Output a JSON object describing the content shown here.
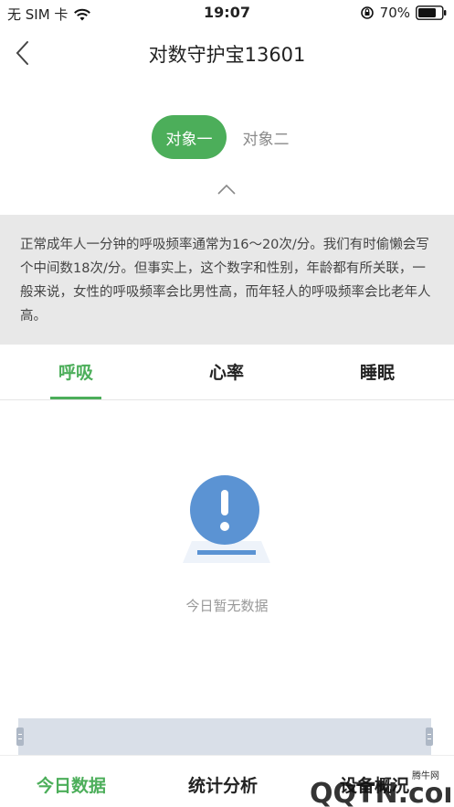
{
  "status_bar": {
    "carrier": "无 SIM 卡",
    "time": "19:07",
    "battery": "70%"
  },
  "nav": {
    "title": "对数守护宝13601"
  },
  "subject_tabs": [
    {
      "label": "对象一",
      "active": true
    },
    {
      "label": "对象二",
      "active": false
    }
  ],
  "info": {
    "text": "正常成年人一分钟的呼吸频率通常为16～20次/分。我们有时偷懒会写个中间数18次/分。但事实上，这个数字和性别，年龄都有所关联，一般来说，女性的呼吸频率会比男性高，而年轻人的呼吸频率会比老年人高。"
  },
  "metric_tabs": [
    {
      "label": "呼吸",
      "active": true
    },
    {
      "label": "心率",
      "active": false
    },
    {
      "label": "睡眠",
      "active": false
    }
  ],
  "empty_state": {
    "text": "今日暂无数据"
  },
  "bottom_tabs": [
    {
      "label": "今日数据",
      "active": true
    },
    {
      "label": "统计分析",
      "active": false
    },
    {
      "label": "设备概况",
      "active": false
    }
  ],
  "watermark": {
    "text": "QQTN.com",
    "subtext": "腾牛网"
  },
  "colors": {
    "accent": "#4cae5a",
    "info_bg": "#e8e8e8",
    "illustration": "#5b93d3"
  }
}
